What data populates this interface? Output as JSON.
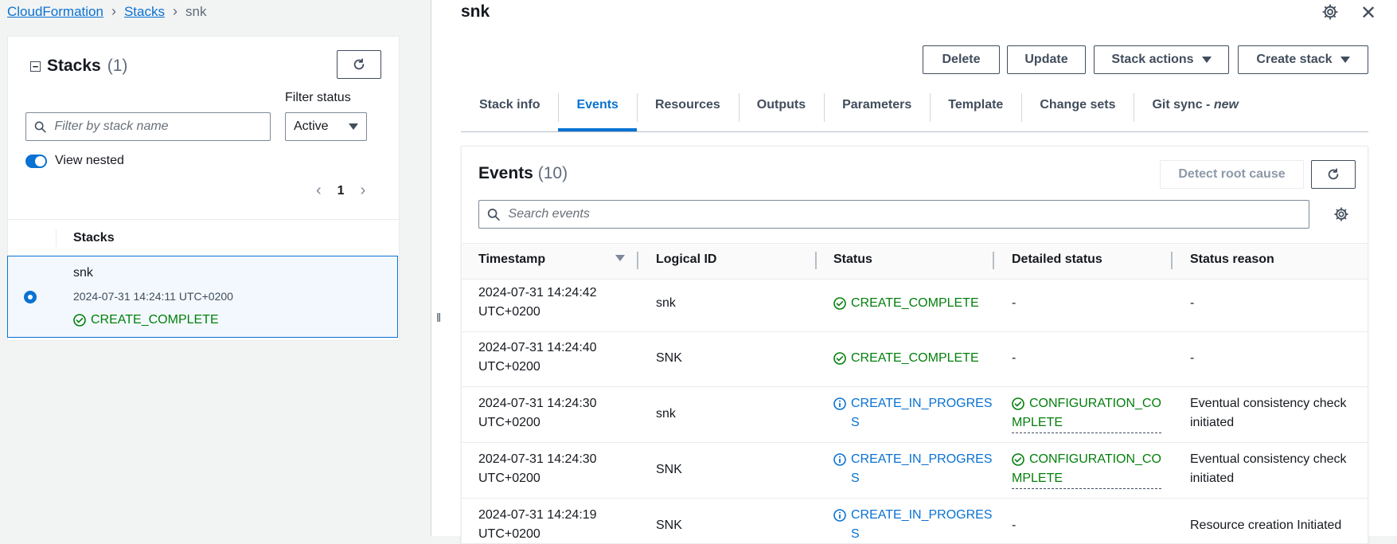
{
  "breadcrumb": {
    "items": [
      "CloudFormation",
      "Stacks"
    ],
    "current": "snk"
  },
  "left": {
    "title": "Stacks",
    "count": "(1)",
    "filter_placeholder": "Filter by stack name",
    "filter_status_label": "Filter status",
    "filter_status_value": "Active",
    "view_nested_label": "View nested",
    "page_number": "1",
    "column_header": "Stacks",
    "stack": {
      "name": "snk",
      "created": "2024-07-31 14:24:11 UTC+0200",
      "status": "CREATE_COMPLETE"
    }
  },
  "right": {
    "title": "snk",
    "buttons": {
      "delete": "Delete",
      "update": "Update",
      "stack_actions": "Stack actions",
      "create_stack": "Create stack"
    },
    "tabs": [
      "Stack info",
      "Events",
      "Resources",
      "Outputs",
      "Parameters",
      "Template",
      "Change sets"
    ],
    "tab_git_sync": "Git sync - ",
    "tab_git_sync_new": "new",
    "events": {
      "title": "Events",
      "count": "(10)",
      "detect_root_cause": "Detect root cause",
      "search_placeholder": "Search events",
      "columns": [
        "Timestamp",
        "Logical ID",
        "Status",
        "Detailed status",
        "Status reason"
      ],
      "rows": [
        {
          "ts1": "2024-07-31 14:24:42",
          "ts2": "UTC+0200",
          "id": "snk",
          "status1": "CREATE_COMPLETE",
          "status2": "",
          "detail1": "-",
          "detail2": "",
          "reason1": "-",
          "reason2": ""
        },
        {
          "ts1": "2024-07-31 14:24:40",
          "ts2": "UTC+0200",
          "id": "SNK",
          "status1": "CREATE_COMPLETE",
          "status2": "",
          "detail1": "-",
          "detail2": "",
          "reason1": "-",
          "reason2": ""
        },
        {
          "ts1": "2024-07-31 14:24:30",
          "ts2": "UTC+0200",
          "id": "snk",
          "status1": "CREATE_IN_PROGRES",
          "status2": "S",
          "detail1": "CONFIGURATION_CO",
          "detail2": "MPLETE",
          "reason1": "Eventual consistency check",
          "reason2": "initiated"
        },
        {
          "ts1": "2024-07-31 14:24:30",
          "ts2": "UTC+0200",
          "id": "SNK",
          "status1": "CREATE_IN_PROGRES",
          "status2": "S",
          "detail1": "CONFIGURATION_CO",
          "detail2": "MPLETE",
          "reason1": "Eventual consistency check",
          "reason2": "initiated"
        },
        {
          "ts1": "2024-07-31 14:24:19",
          "ts2": "UTC+0200",
          "id": "SNK",
          "status1": "CREATE_IN_PROGRES",
          "status2": "S",
          "detail1": "-",
          "detail2": "",
          "reason1": "Resource creation Initiated",
          "reason2": ""
        }
      ]
    }
  },
  "colors": {
    "link": "#0972d3",
    "success": "#037f0c",
    "text": "#16191f"
  }
}
